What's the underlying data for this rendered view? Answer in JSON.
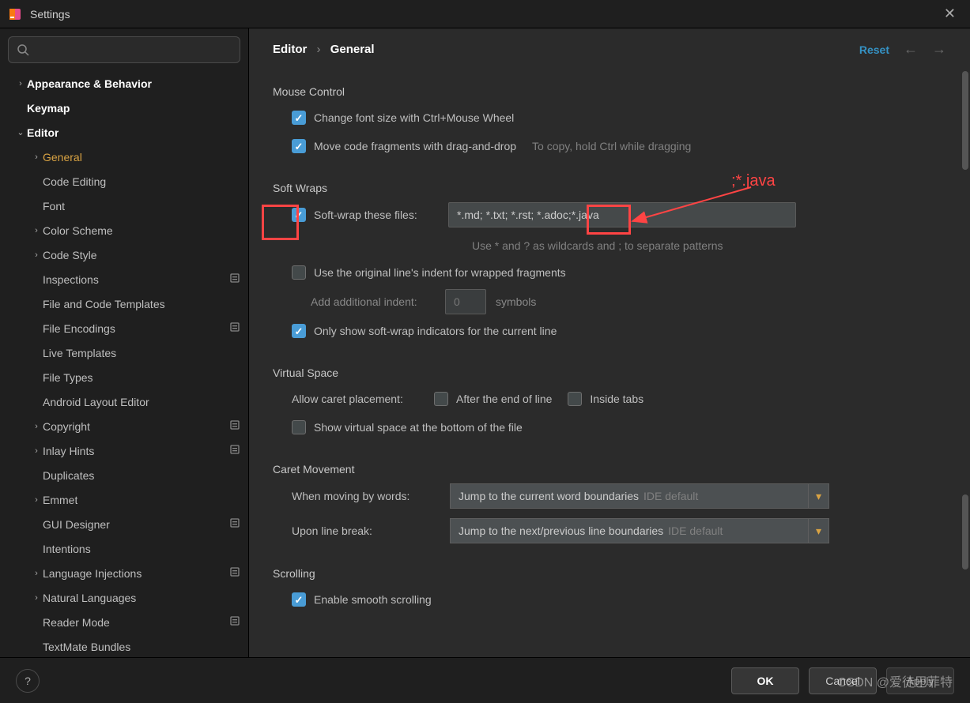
{
  "window": {
    "title": "Settings"
  },
  "search": {
    "placeholder": ""
  },
  "sidebar": {
    "items": [
      {
        "label": "Appearance & Behavior",
        "depth": 0,
        "chevron": "right",
        "bold": true
      },
      {
        "label": "Keymap",
        "depth": 0,
        "bold": true
      },
      {
        "label": "Editor",
        "depth": 0,
        "chevron": "down",
        "bold": true
      },
      {
        "label": "General",
        "depth": 1,
        "chevron": "right",
        "selected": true
      },
      {
        "label": "Code Editing",
        "depth": 1
      },
      {
        "label": "Font",
        "depth": 1
      },
      {
        "label": "Color Scheme",
        "depth": 1,
        "chevron": "right"
      },
      {
        "label": "Code Style",
        "depth": 1,
        "chevron": "right"
      },
      {
        "label": "Inspections",
        "depth": 1,
        "modified": true
      },
      {
        "label": "File and Code Templates",
        "depth": 1
      },
      {
        "label": "File Encodings",
        "depth": 1,
        "modified": true
      },
      {
        "label": "Live Templates",
        "depth": 1
      },
      {
        "label": "File Types",
        "depth": 1
      },
      {
        "label": "Android Layout Editor",
        "depth": 1
      },
      {
        "label": "Copyright",
        "depth": 1,
        "chevron": "right",
        "modified": true
      },
      {
        "label": "Inlay Hints",
        "depth": 1,
        "chevron": "right",
        "modified": true
      },
      {
        "label": "Duplicates",
        "depth": 1
      },
      {
        "label": "Emmet",
        "depth": 1,
        "chevron": "right"
      },
      {
        "label": "GUI Designer",
        "depth": 1,
        "modified": true
      },
      {
        "label": "Intentions",
        "depth": 1
      },
      {
        "label": "Language Injections",
        "depth": 1,
        "chevron": "right",
        "modified": true
      },
      {
        "label": "Natural Languages",
        "depth": 1,
        "chevron": "right"
      },
      {
        "label": "Reader Mode",
        "depth": 1,
        "modified": true
      },
      {
        "label": "TextMate Bundles",
        "depth": 1
      }
    ]
  },
  "breadcrumb": {
    "root": "Editor",
    "current": "General"
  },
  "header": {
    "reset": "Reset"
  },
  "sections": {
    "mouse": {
      "title": "Mouse Control",
      "change_font": "Change font size with Ctrl+Mouse Wheel",
      "move_frag": "Move code fragments with drag-and-drop",
      "move_hint": "To copy, hold Ctrl while dragging"
    },
    "softwraps": {
      "title": "Soft Wraps",
      "wrap_label": "Soft-wrap these files:",
      "wrap_value": "*.md; *.txt; *.rst; *.adoc;*.java",
      "wrap_help": "Use * and ? as wildcards and ; to separate patterns",
      "use_orig": "Use the original line's indent for wrapped fragments",
      "add_indent_label": "Add additional indent:",
      "add_indent_value": "0",
      "add_indent_suffix": "symbols",
      "only_show": "Only show soft-wrap indicators for the current line"
    },
    "virtual": {
      "title": "Virtual Space",
      "allow_label": "Allow caret placement:",
      "after_eol": "After the end of line",
      "inside_tabs": "Inside tabs",
      "show_bottom": "Show virtual space at the bottom of the file"
    },
    "caret": {
      "title": "Caret Movement",
      "by_words_label": "When moving by words:",
      "by_words_value": "Jump to the current word boundaries",
      "line_break_label": "Upon line break:",
      "line_break_value": "Jump to the next/previous line boundaries",
      "default_suffix": "IDE default"
    },
    "scrolling": {
      "title": "Scrolling",
      "smooth": "Enable smooth scrolling"
    }
  },
  "footer": {
    "ok": "OK",
    "cancel": "Cancel",
    "apply": "Apply"
  },
  "annotation": {
    "text": ";*.java"
  },
  "watermark": "CSDN @爱徒巴菲特"
}
